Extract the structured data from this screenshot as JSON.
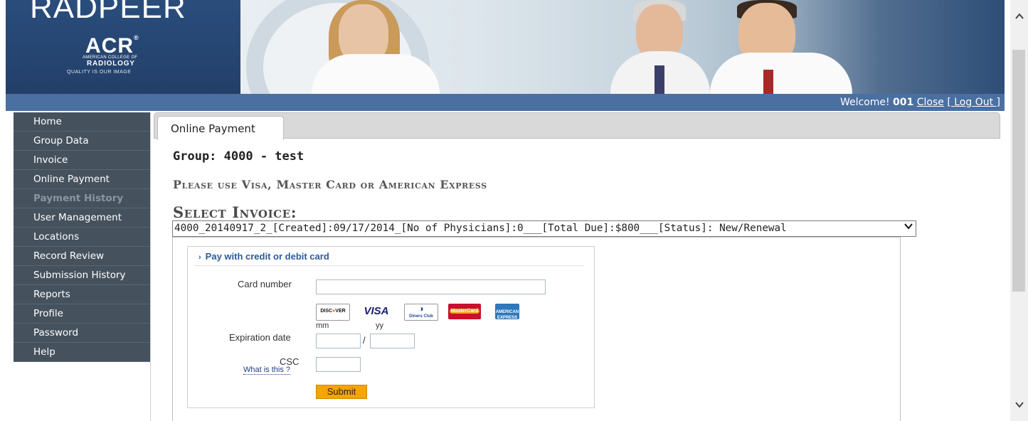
{
  "banner": {
    "product": "RADPEER",
    "org_abbr": "ACR",
    "org_reg": "®",
    "org_line1": "AMERICAN COLLEGE OF",
    "org_line2": "RADIOLOGY",
    "tagline": "QUALITY IS OUR IMAGE"
  },
  "welcome": {
    "prefix": "Welcome!",
    "user": "001",
    "close_label": "Close",
    "logout_label": "[ Log Out ]"
  },
  "sidebar": {
    "items": [
      {
        "label": "Home",
        "state": "normal"
      },
      {
        "label": "Group Data",
        "state": "normal"
      },
      {
        "label": "Invoice",
        "state": "normal"
      },
      {
        "label": "Online Payment",
        "state": "normal"
      },
      {
        "label": "Payment History",
        "state": "disabled"
      },
      {
        "label": "User Management",
        "state": "normal"
      },
      {
        "label": "Locations",
        "state": "normal"
      },
      {
        "label": "Record Review",
        "state": "normal"
      },
      {
        "label": "Submission History",
        "state": "normal"
      },
      {
        "label": "Reports",
        "state": "normal"
      },
      {
        "label": "Profile",
        "state": "normal"
      },
      {
        "label": "Password",
        "state": "normal"
      },
      {
        "label": "Help",
        "state": "normal"
      }
    ]
  },
  "main": {
    "tab_label": "Online Payment",
    "group_title": "Group: 4000 - test",
    "notice": "Please use Visa, Master Card or American Express",
    "select_label": "Select Invoice:",
    "invoice_selected": "4000_20140917_2_[Created]:09/17/2014_[No of Physicians]:0___[Total Due]:$800___[Status]: New/Renewal"
  },
  "payment_form": {
    "heading": "Pay with credit or debit card",
    "heading_icon": "chevron-right-icon",
    "card_number_label": "Card number",
    "card_number_value": "",
    "cards": [
      "DISCOVER",
      "VISA",
      "Diners Club International",
      "MasterCard",
      "American Express"
    ],
    "expiration_label": "Expiration date",
    "month_label": "mm",
    "year_label": "yy",
    "month_value": "",
    "year_value": "",
    "date_separator": "/",
    "csc_label": "CSC",
    "csc_help": "What is this ?",
    "csc_value": "",
    "submit_label": "Submit"
  },
  "colors": {
    "banner": "#24446e",
    "welcome_bar": "#4a6fa1",
    "sidebar": "#45525e",
    "submit": "#f5a400",
    "link": "#2a5a9c"
  }
}
